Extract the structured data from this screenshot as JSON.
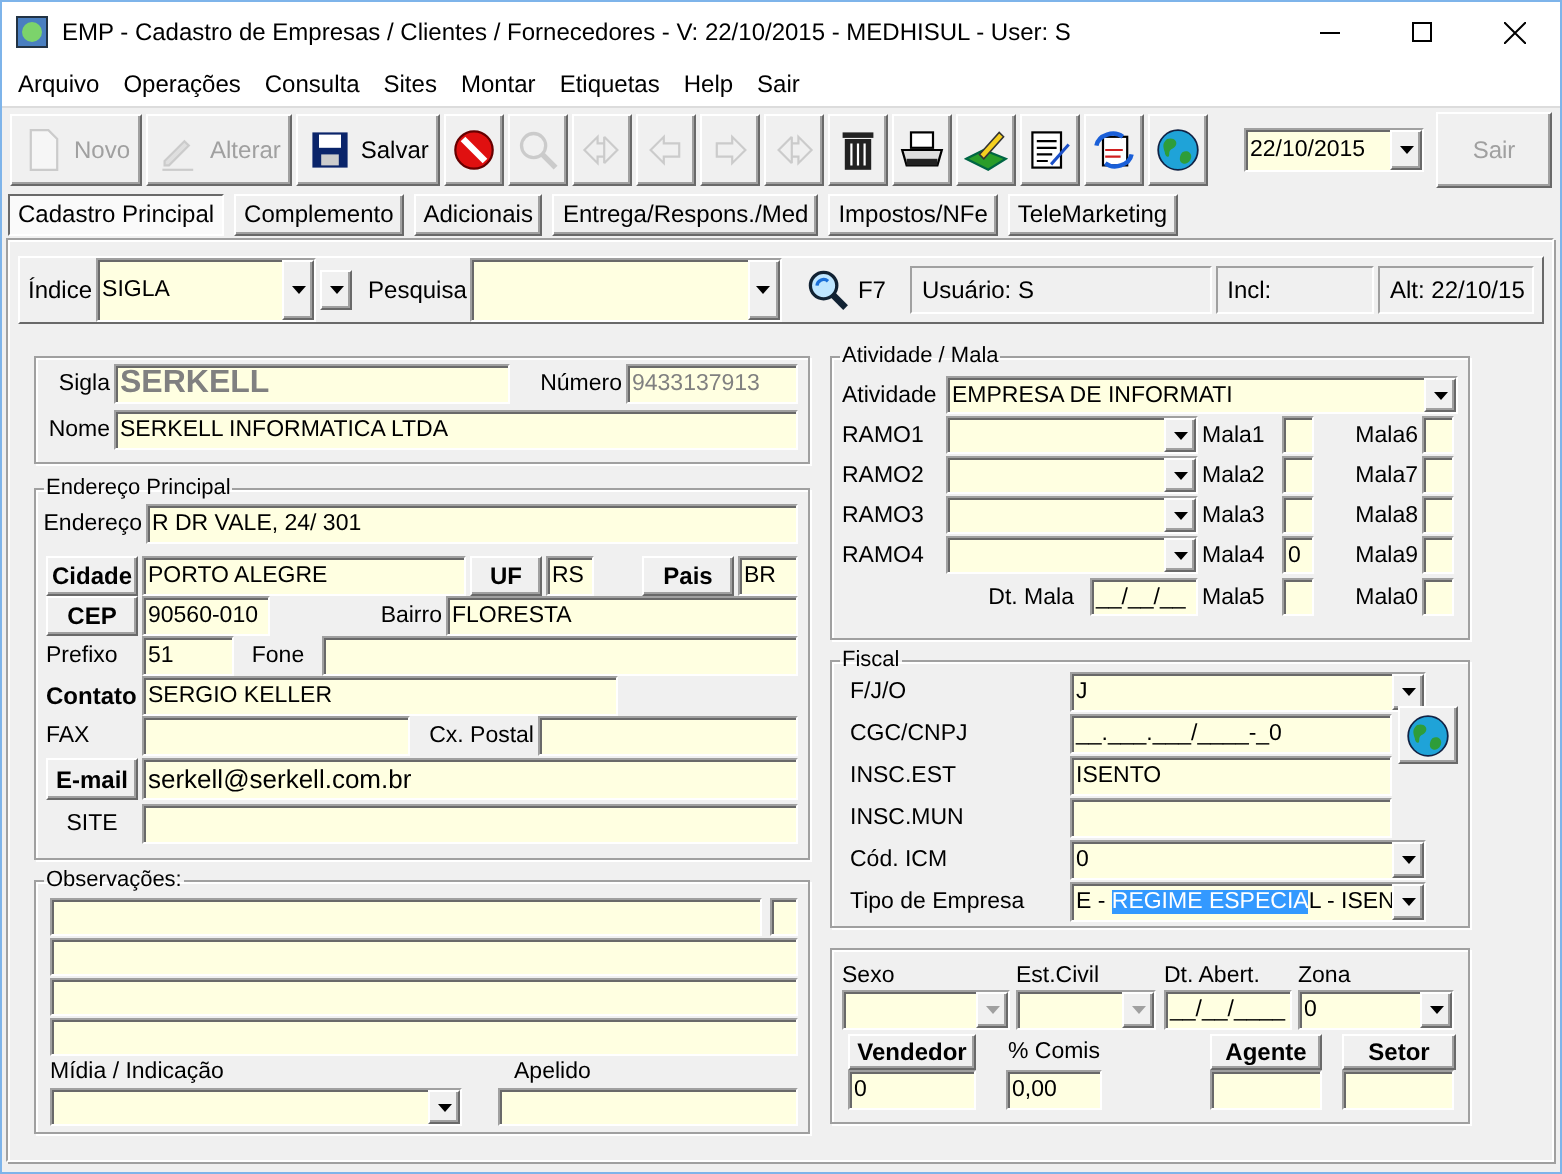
{
  "window": {
    "title": "EMP - Cadastro de Empresas / Clientes / Fornecedores - V: 22/10/2015 - MEDHISUL - User: S"
  },
  "menu": [
    "Arquivo",
    "Operações",
    "Consulta",
    "Sites",
    "Montar",
    "Etiquetas",
    "Help",
    "Sair"
  ],
  "toolbar": {
    "buttons": [
      {
        "kind": "new",
        "label": "Novo",
        "disabled": true
      },
      {
        "kind": "edit",
        "label": "Alterar",
        "disabled": true
      },
      {
        "kind": "save",
        "label": "Salvar",
        "disabled": false
      },
      {
        "kind": "cancel",
        "disabled": false
      },
      {
        "kind": "find",
        "disabled": true
      },
      {
        "kind": "first",
        "disabled": true
      },
      {
        "kind": "prev",
        "disabled": true
      },
      {
        "kind": "next",
        "disabled": true
      },
      {
        "kind": "last",
        "disabled": true
      },
      {
        "kind": "delete",
        "disabled": false
      },
      {
        "kind": "print",
        "disabled": false
      },
      {
        "kind": "sign",
        "disabled": false
      },
      {
        "kind": "notes",
        "disabled": false
      },
      {
        "kind": "refresh",
        "disabled": false
      },
      {
        "kind": "globe",
        "disabled": false
      }
    ],
    "date": "22/10/2015",
    "exit": {
      "label": "Sair",
      "disabled": true
    }
  },
  "tabs": [
    {
      "label": "Cadastro Principal",
      "selected": true
    },
    {
      "label": "Complemento",
      "selected": false
    },
    {
      "label": "Adicionais",
      "selected": false
    },
    {
      "label": "Entrega/Respons./Med",
      "selected": false
    },
    {
      "label": "Impostos/NFe",
      "selected": false
    },
    {
      "label": "TeleMarketing",
      "selected": false
    }
  ],
  "search": {
    "index_label": "Índice",
    "index_value": "SIGLA",
    "search_label": "Pesquisa",
    "shortcut": "F7",
    "user": "Usuário: S",
    "created": "Incl:",
    "altered": "Alt: 22/10/15"
  },
  "identification": {
    "sigla": {
      "label": "Sigla",
      "value": "SERKELL",
      "disabled": true
    },
    "number": {
      "label": "Número",
      "value": "9433137913",
      "disabled": true
    },
    "name": {
      "label": "Nome",
      "value": "SERKELL INFORMATICA LTDA",
      "disabled": false
    }
  },
  "address": {
    "title": "Endereço Principal",
    "street": {
      "label": "Endereço",
      "value": "R DR VALE, 24/ 301"
    },
    "city": {
      "label": "Cidade",
      "value": "PORTO ALEGRE"
    },
    "state": {
      "label": "UF",
      "value": "RS"
    },
    "country": {
      "label": "Pais",
      "value": "BR"
    },
    "zip": {
      "label": "CEP",
      "value": "90560-010"
    },
    "district": {
      "label": "Bairro",
      "value": "FLORESTA"
    },
    "area_code": {
      "label": "Prefixo",
      "value": "51"
    },
    "phone": {
      "label": "Fone"
    },
    "contact": {
      "label": "Contato",
      "value": "SERGIO KELLER"
    },
    "fax": {
      "label": "FAX"
    },
    "po_box": {
      "label": "Cx. Postal"
    },
    "email": {
      "label": "E-mail",
      "value": "serkell@serkell.com.br"
    },
    "site": {
      "label": "SITE"
    }
  },
  "notes": {
    "title": "Observações:",
    "media": {
      "label": "Mídia / Indicação"
    },
    "nickname": {
      "label": "Apelido"
    }
  },
  "activity": {
    "title": "Atividade / Mala",
    "activity": {
      "label": "Atividade",
      "value": "EMPRESA DE INFORMATI"
    },
    "branches": [
      {
        "label": "RAMO1"
      },
      {
        "label": "RAMO2"
      },
      {
        "label": "RAMO3"
      },
      {
        "label": "RAMO4"
      }
    ],
    "mail": [
      {
        "label": "Mala1"
      },
      {
        "label": "Mala2"
      },
      {
        "label": "Mala3"
      },
      {
        "label": "Mala4",
        "value": "0"
      },
      {
        "label": "Mala5"
      },
      {
        "label": "Mala6"
      },
      {
        "label": "Mala7"
      },
      {
        "label": "Mala8"
      },
      {
        "label": "Mala9"
      },
      {
        "label": "Mala0"
      }
    ],
    "mail_date": {
      "label": "Dt. Mala",
      "value": "__/__/__"
    }
  },
  "fiscal": {
    "title": "Fiscal",
    "rows": [
      {
        "label": "F/J/O",
        "kind": "combo",
        "value": "J"
      },
      {
        "label": "CGC/CNPJ",
        "kind": "input",
        "value": "__.___.___/____-_0"
      },
      {
        "label": "INSC.EST",
        "kind": "input",
        "value": "ISENTO"
      },
      {
        "label": "INSC.MUN",
        "kind": "input"
      },
      {
        "label": "Cód. ICM",
        "kind": "combo",
        "value": "0"
      },
      {
        "label": "Tipo de Empresa",
        "kind": "combo",
        "value": "E - ",
        "selection": "REGIME ESPECIA",
        "value_end": "L - ISEN"
      }
    ]
  },
  "other": {
    "sex": {
      "label": "Sexo",
      "disabled": true
    },
    "civil_status": {
      "label": "Est.Civil",
      "disabled": true
    },
    "opening_date": {
      "label": "Dt. Abert.",
      "value": "__/__/____"
    },
    "zone": {
      "label": "Zona",
      "value": "0",
      "disabled": false
    },
    "seller": {
      "label": "Vendedor",
      "value": "0"
    },
    "commission": {
      "label": "% Comis",
      "value": "0,00"
    },
    "agent": {
      "label": "Agente"
    },
    "sector": {
      "label": "Setor"
    }
  }
}
